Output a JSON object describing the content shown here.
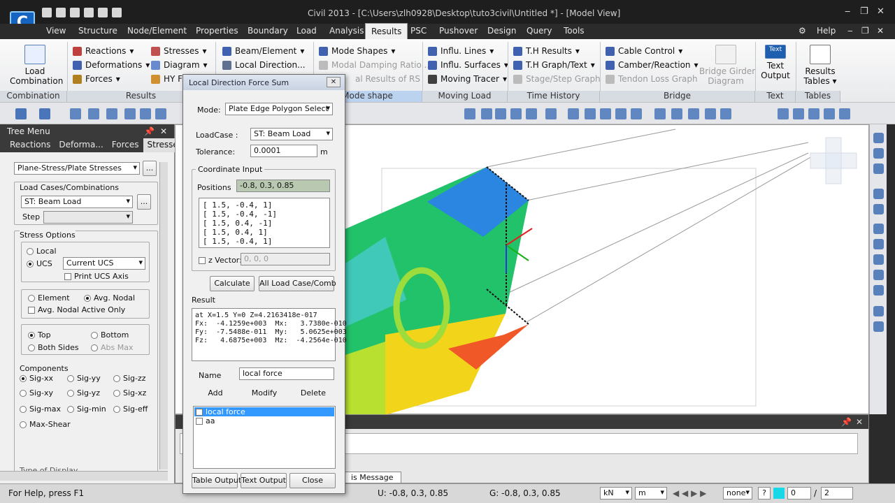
{
  "window": {
    "title": "Civil 2013 - [C:\\Users\\zlh0928\\Desktop\\tuto3civil\\Untitled *] - [Model View]",
    "logo": "C",
    "controls": [
      "‒",
      "❐",
      "✕"
    ]
  },
  "menu": {
    "items": [
      "View",
      "Structure",
      "Node/Element",
      "Properties",
      "Boundary",
      "Load",
      "Analysis",
      "Results",
      "PSC",
      "Pushover",
      "Design",
      "Query",
      "Tools"
    ],
    "active": "Results",
    "help": "Help",
    "right_controls": [
      "‒",
      "❐",
      "✕"
    ]
  },
  "ribbon": {
    "combination": {
      "button": "Load\nCombination",
      "group": "Combination"
    },
    "results": {
      "items": [
        "Reactions",
        "Deformations",
        "Forces",
        "Stresses",
        "Diagram",
        "HY F"
      ],
      "group": "Results"
    },
    "beam": {
      "items": [
        "Beam/Element",
        "Local Direction..."
      ]
    },
    "mode": {
      "items": [
        "Mode Shapes",
        "Modal Damping Ratio...",
        "al Results of RS"
      ],
      "group": "Mode shape"
    },
    "moving": {
      "items": [
        "Influ. Lines",
        "Influ. Surfaces",
        "Moving Tracer"
      ],
      "group": "Moving Load"
    },
    "time": {
      "items": [
        "T.H Results",
        "T.H Graph/Text",
        "Stage/Step Graph"
      ],
      "group": "Time History"
    },
    "bridge": {
      "items": [
        "Cable Control",
        "Camber/Reaction",
        "Tendon Loss Graph"
      ],
      "big": "Bridge Girder\nDiagram",
      "group": "Bridge"
    },
    "text": {
      "button": "Text\nOutput",
      "group": "Text",
      "icon_label": "Text"
    },
    "tables": {
      "button": "Results\nTables",
      "group": "Tables"
    }
  },
  "tree": {
    "header": "Tree Menu",
    "tabs": [
      "Reactions",
      "Deforma...",
      "Forces",
      "Stresses"
    ],
    "active_tab": "Stresses",
    "stress_type": "Plane-Stress/Plate Stresses",
    "load_cases_label": "Load Cases/Combinations",
    "load_case": "ST: Beam Load",
    "step_label": "Step",
    "stress_options_label": "Stress Options",
    "local": "Local",
    "ucs": "UCS",
    "ucs_value": "Current UCS",
    "print_ucs": "Print UCS Axis",
    "element": "Element",
    "avg_nodal": "Avg. Nodal",
    "avg_nodal_active": "Avg. Nodal Active Only",
    "top": "Top",
    "bottom": "Bottom",
    "both_sides": "Both Sides",
    "abs_max": "Abs Max",
    "components_label": "Components",
    "components": [
      "Sig-xx",
      "Sig-yy",
      "Sig-zz",
      "Sig-xy",
      "Sig-yz",
      "Sig-xz",
      "Sig-max",
      "Sig-min",
      "Sig-eff",
      "Max-Shear"
    ],
    "type_display": "Type of Display"
  },
  "dialog": {
    "title": "Local Direction Force Sum",
    "mode_label": "Mode:",
    "mode_value": "Plate Edge Polygon Select",
    "loadcase_label": "LoadCase :",
    "loadcase_value": "ST: Beam Load",
    "tolerance_label": "Tolerance:",
    "tolerance_value": "0.0001",
    "tolerance_unit": "m",
    "coord_label": "Coordinate Input",
    "positions_label": "Positions",
    "positions_value": "-0.8, 0.3, 0.85",
    "positions_list": [
      "[ 1.5, -0.4, 1]",
      "[ 1.5, -0.4, -1]",
      "[ 1.5, 0.4, -1]",
      "[ 1.5, 0.4, 1]",
      "[ 1.5, -0.4, 1]"
    ],
    "zvector_label": "z Vector:",
    "zvector_value": "0, 0, 0",
    "calculate": "Calculate",
    "all_load": "All Load Case/Comb",
    "result_label": "Result",
    "result_lines": [
      "at X=1.5 Y=0 Z=4.2163418e-017",
      "Fx:  -4.1259e+003  Mx:   3.7380e-010",
      "Fy:  -7.5488e-011  My:   5.0625e+003",
      "Fz:   4.6875e+003  Mz:  -4.2564e-010"
    ],
    "name_label": "Name",
    "name_value": "local force",
    "add": "Add",
    "modify": "Modify",
    "delete": "Delete",
    "saved": [
      "local force",
      "aa"
    ],
    "table_output": "Table Output",
    "text_output": "Text Output",
    "close": "Close"
  },
  "message": {
    "tab": "is Message"
  },
  "status": {
    "help": "For Help, press F1",
    "u": "U: -0.8, 0.3, 0.85",
    "g": "G: -0.8, 0.3, 0.85",
    "force_unit": "kN",
    "length_unit": "m",
    "none": "none",
    "q": "?",
    "zero": "0",
    "page": "2"
  }
}
